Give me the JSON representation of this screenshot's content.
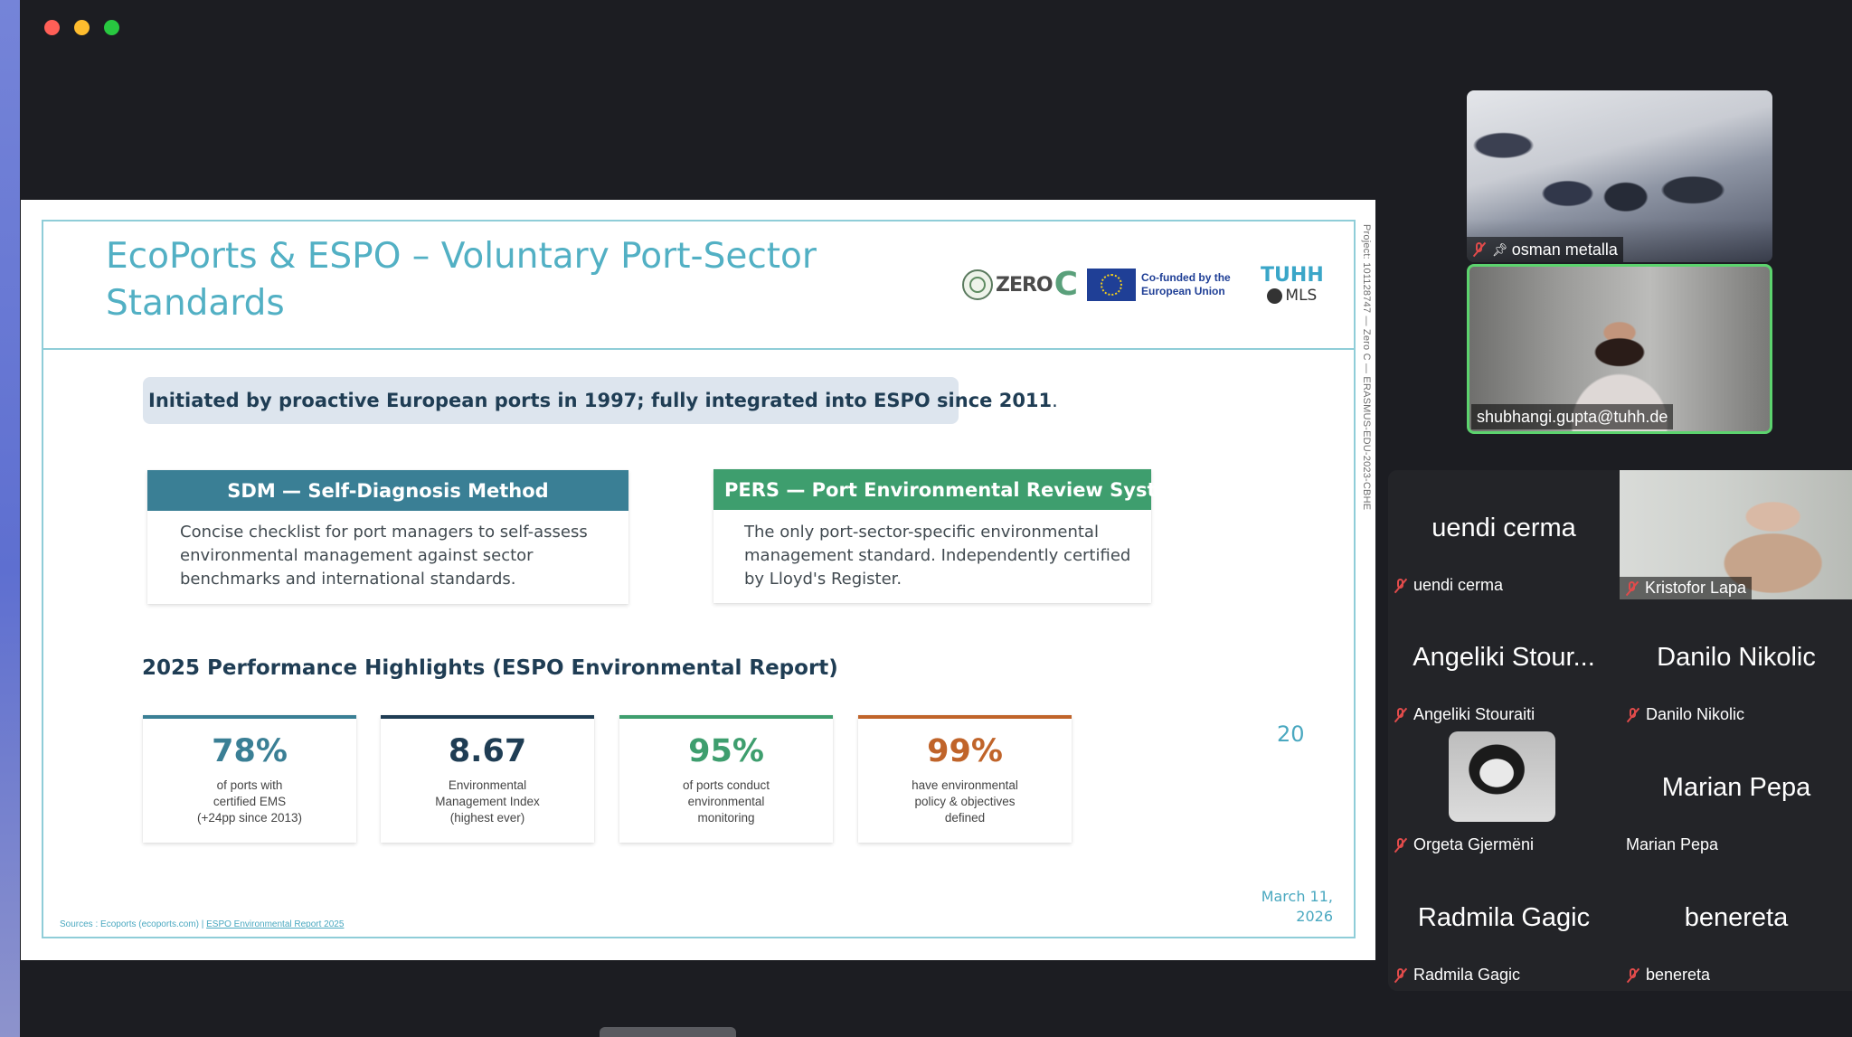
{
  "slide": {
    "title": "EcoPorts & ESPO – Voluntary Port-Sector Standards",
    "logos": {
      "zeroc_text": "ZERO",
      "zeroc_letter": "C",
      "eu_text": "Co-funded by the European Union",
      "tuhh_name": "TUHH",
      "tuhh_sub": "MLS"
    },
    "side_caption": "Project: 101128747 — Zero C — ERASMUS-EDU-2023-CBHE",
    "intro": "Initiated by proactive European ports in 1997; fully integrated into ESPO since 2011",
    "intro_period": ".",
    "cards": [
      {
        "title": "SDM — Self-Diagnosis Method",
        "body": "Concise checklist for port managers to self-assess environmental management against sector benchmarks and international standards."
      },
      {
        "title": "PERS — Port Environmental Review System",
        "body": "The only port-sector-specific environmental management standard. Independently certified by Lloyd's Register."
      }
    ],
    "highlights_heading": "2025 Performance Highlights (ESPO Environmental Report)",
    "stats": [
      {
        "value": "78%",
        "caption": [
          "of ports with",
          "certified EMS",
          "(+24pp since 2013)"
        ],
        "color": "#3a7f95"
      },
      {
        "value": "8.67",
        "caption": [
          "Environmental",
          "Management Index",
          "(highest ever)"
        ],
        "color": "#1f3d54"
      },
      {
        "value": "95%",
        "caption": [
          "of ports conduct",
          "environmental",
          "monitoring"
        ],
        "color": "#3e9e6e"
      },
      {
        "value": "99%",
        "caption": [
          "have environmental",
          "policy & objectives",
          "defined"
        ],
        "color": "#c0642a"
      }
    ],
    "page_number": "20",
    "date_line1": "March 11,",
    "date_line2": "2026",
    "sources_prefix": "Sources : Ecoports (ecoports.com) | ",
    "sources_link": "ESPO Environmental Report 2025"
  },
  "videos": [
    {
      "name": "osman metalla",
      "muted": true,
      "pinned": true
    },
    {
      "name": "shubhangi.gupta@tuhh.de",
      "muted": false,
      "active_speaker": true
    }
  ],
  "participants": [
    {
      "display": "uendi cerma",
      "label": "uendi cerma",
      "muted": true
    },
    {
      "display": "",
      "label": "Kristofor Lapa",
      "muted": true,
      "video": true
    },
    {
      "display": "Angeliki Stour...",
      "label": "Angeliki Stouraiti",
      "muted": true
    },
    {
      "display": "Danilo Nikolic",
      "label": "Danilo Nikolic",
      "muted": true
    },
    {
      "display": "",
      "label": "Orgeta Gjermëni",
      "muted": true,
      "avatar": true
    },
    {
      "display": "Marian Pepa",
      "label": "Marian Pepa",
      "muted": false
    },
    {
      "display": "Radmila Gagic",
      "label": "Radmila Gagic",
      "muted": true
    },
    {
      "display": "benereta",
      "label": "benereta",
      "muted": true
    }
  ],
  "icons": {
    "mic_muted": "mic-muted-icon",
    "pin": "pin-icon",
    "muted_color": "#e14b4b"
  },
  "colors": {
    "title": "#52b0c4",
    "frame": "#8fcdd8",
    "active_speaker_border": "#5cd36e"
  }
}
